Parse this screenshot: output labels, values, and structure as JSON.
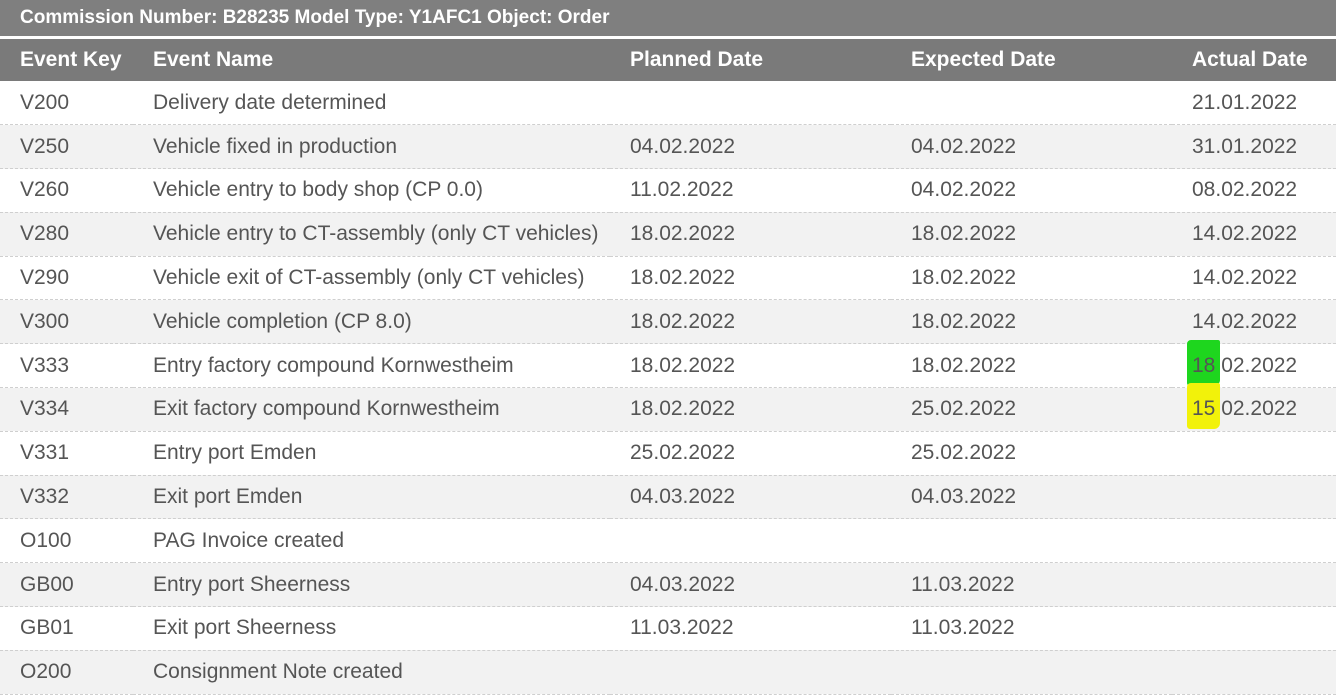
{
  "header": {
    "title": "Commission Number: B28235  Model Type: Y1AFC1  Object: Order"
  },
  "columns": {
    "event_key": "Event Key",
    "event_name": "Event Name",
    "planned_date": "Planned Date",
    "expected_date": "Expected Date",
    "actual_date": "Actual Date"
  },
  "highlight_colors": {
    "green": "#1ed61e",
    "yellow": "#f2f20a"
  },
  "rows": [
    {
      "key": "V200",
      "name": "Delivery date determined",
      "planned": "",
      "expected": "",
      "actual": "21.01.2022"
    },
    {
      "key": "V250",
      "name": "Vehicle fixed in production",
      "planned": "04.02.2022",
      "expected": "04.02.2022",
      "actual": "31.01.2022"
    },
    {
      "key": "V260",
      "name": "Vehicle entry to body shop (CP 0.0)",
      "planned": "11.02.2022",
      "expected": "04.02.2022",
      "actual": "08.02.2022"
    },
    {
      "key": "V280",
      "name": "Vehicle entry to CT-assembly (only CT vehicles)",
      "planned": "18.02.2022",
      "expected": "18.02.2022",
      "actual": "14.02.2022"
    },
    {
      "key": "V290",
      "name": "Vehicle exit of CT-assembly (only CT vehicles)",
      "planned": "18.02.2022",
      "expected": "18.02.2022",
      "actual": "14.02.2022"
    },
    {
      "key": "V300",
      "name": "Vehicle completion (CP 8.0)",
      "planned": "18.02.2022",
      "expected": "18.02.2022",
      "actual": "14.02.2022"
    },
    {
      "key": "V333",
      "name": "Entry factory compound Kornwestheim",
      "planned": "18.02.2022",
      "expected": "18.02.2022",
      "actual_day": "18",
      "actual_rest": ".02.2022",
      "highlight": "green"
    },
    {
      "key": "V334",
      "name": "Exit factory compound Kornwestheim",
      "planned": "18.02.2022",
      "expected": "25.02.2022",
      "actual_day": "15",
      "actual_rest": ".02.2022",
      "highlight": "yellow"
    },
    {
      "key": "V331",
      "name": "Entry port Emden",
      "planned": "25.02.2022",
      "expected": "25.02.2022",
      "actual": ""
    },
    {
      "key": "V332",
      "name": "Exit port Emden",
      "planned": "04.03.2022",
      "expected": "04.03.2022",
      "actual": ""
    },
    {
      "key": "O100",
      "name": "PAG Invoice created",
      "planned": "",
      "expected": "",
      "actual": ""
    },
    {
      "key": "GB00",
      "name": "Entry port Sheerness",
      "planned": "04.03.2022",
      "expected": "11.03.2022",
      "actual": ""
    },
    {
      "key": "GB01",
      "name": "Exit port Sheerness",
      "planned": "11.03.2022",
      "expected": "11.03.2022",
      "actual": ""
    },
    {
      "key": "O200",
      "name": "Consignment Note created",
      "planned": "",
      "expected": "",
      "actual": ""
    }
  ]
}
